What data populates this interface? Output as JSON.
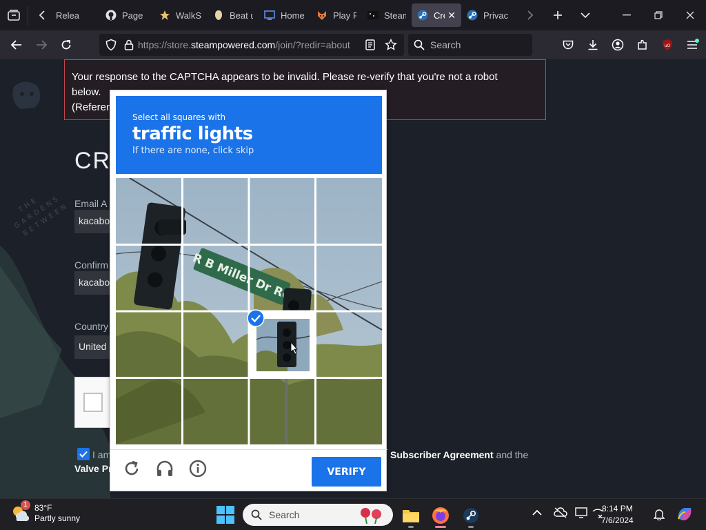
{
  "browser": {
    "tabs": [
      {
        "label": "Relea",
        "icon": "page-icon"
      },
      {
        "label": "Page",
        "icon": "github-icon"
      },
      {
        "label": "WalkS",
        "icon": "star-icon"
      },
      {
        "label": "Beat u",
        "icon": "shield-icon"
      },
      {
        "label": "Home",
        "icon": "monitor-icon"
      },
      {
        "label": "Play F",
        "icon": "fox-icon"
      },
      {
        "label": "Steam",
        "icon": "steam-dark-icon"
      },
      {
        "label": "Cre",
        "icon": "steam-icon",
        "active": true
      },
      {
        "label": "Privac",
        "icon": "steam-icon"
      }
    ],
    "url_prefix": "https://store.",
    "url_domain": "steampowered.com",
    "url_suffix": "/join/?redir=about",
    "search_placeholder": "Search"
  },
  "page": {
    "error_line1": "Your response to the CAPTCHA appears to be invalid. Please re-verify that you're not a robot",
    "error_line2": "below.",
    "error_line3": "(Referen",
    "title": "CR",
    "email_label": "Email A",
    "email_value": "kacabo",
    "confirm_label": "Confirm",
    "confirm_value": "kacabo",
    "country_label": "Country",
    "country_value": "United",
    "agree_start": "I am",
    "agree_link1": "Subscriber Agreement",
    "agree_mid": "and the",
    "agree_link2": "Valve Pr"
  },
  "captcha": {
    "instruction": "Select all squares with",
    "target": "traffic lights",
    "hint": "If there are none, click skip",
    "verify_label": "VERIFY",
    "sign_text": "R B Miller Dr Rd",
    "accent": "#1a73e8"
  },
  "taskbar": {
    "temperature": "83°F",
    "condition": "Partly sunny",
    "weather_badge": "1",
    "search_placeholder": "Search",
    "time": "8:14 PM",
    "date": "7/6/2024"
  }
}
